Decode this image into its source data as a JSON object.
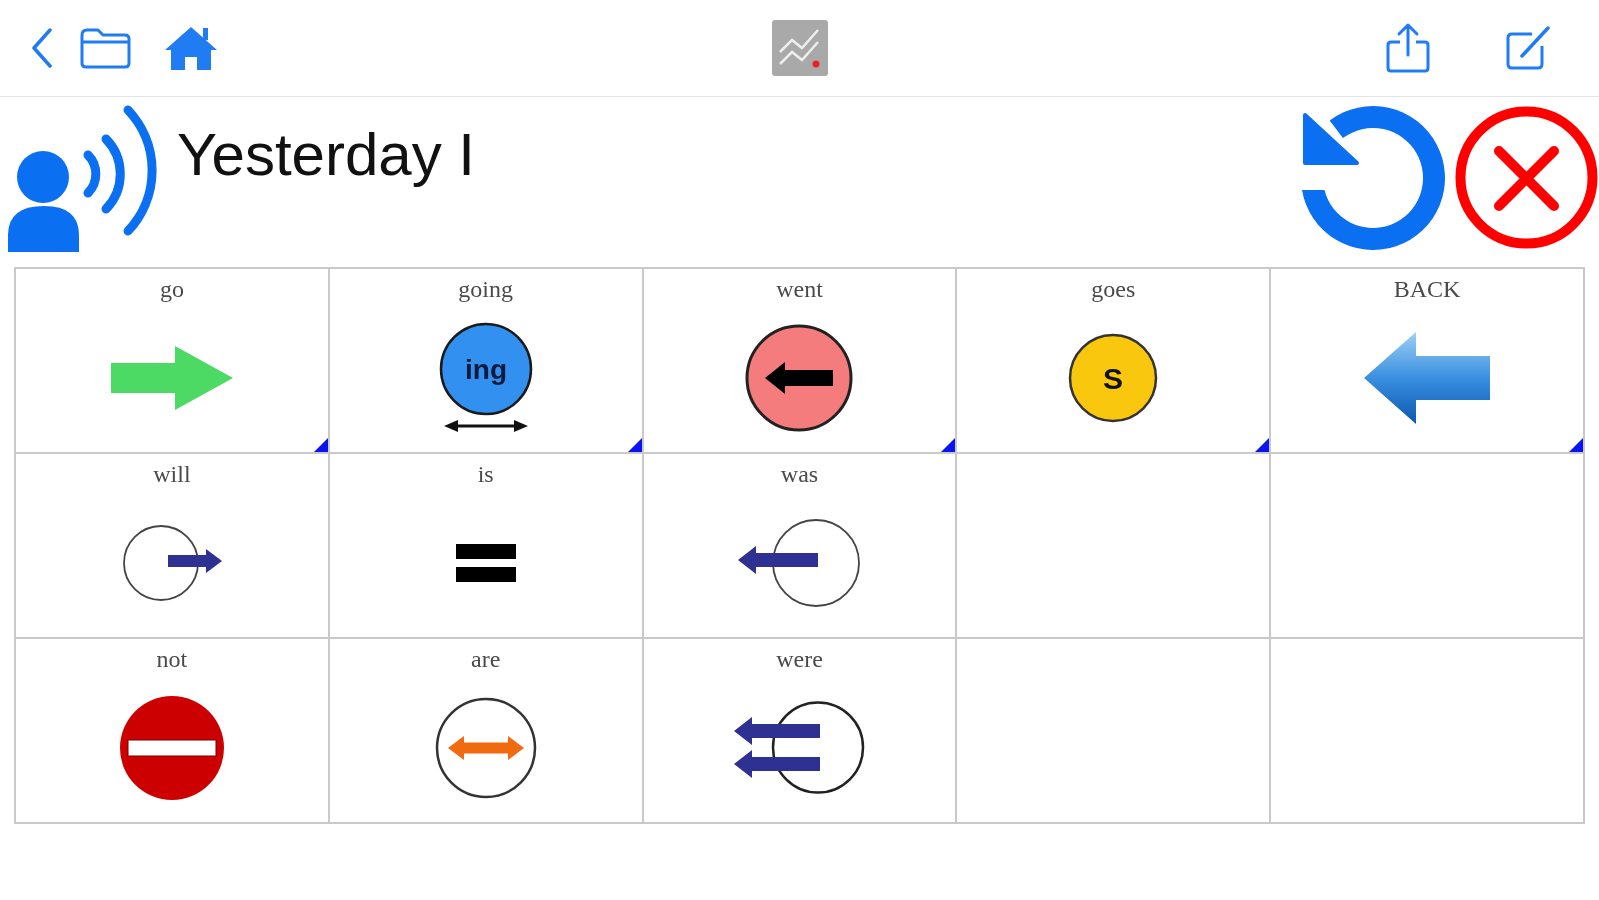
{
  "message_bar": {
    "text": "Yesterday I"
  },
  "grid": {
    "rows": [
      {
        "cells": [
          {
            "label": "go",
            "kind": "forward",
            "linked": true
          },
          {
            "label": "going",
            "kind": "ongoing",
            "symbol_text": "ing",
            "linked": true
          },
          {
            "label": "went",
            "kind": "past",
            "linked": true
          },
          {
            "label": "goes",
            "kind": "third",
            "symbol_text": "S",
            "linked": true
          },
          {
            "label": "BACK",
            "kind": "back",
            "linked": true
          }
        ]
      },
      {
        "cells": [
          {
            "label": "will",
            "kind": "future",
            "linked": false
          },
          {
            "label": "is",
            "kind": "equals",
            "linked": false
          },
          {
            "label": "was",
            "kind": "before",
            "linked": false
          },
          {
            "kind": "empty",
            "linked": false
          },
          {
            "kind": "empty",
            "linked": false
          }
        ]
      },
      {
        "cells": [
          {
            "label": "not",
            "kind": "stop",
            "linked": false
          },
          {
            "label": "are",
            "kind": "between",
            "linked": false
          },
          {
            "label": "were",
            "kind": "pastplural",
            "linked": false
          },
          {
            "kind": "empty",
            "linked": false
          },
          {
            "kind": "empty",
            "linked": false
          }
        ]
      }
    ]
  }
}
